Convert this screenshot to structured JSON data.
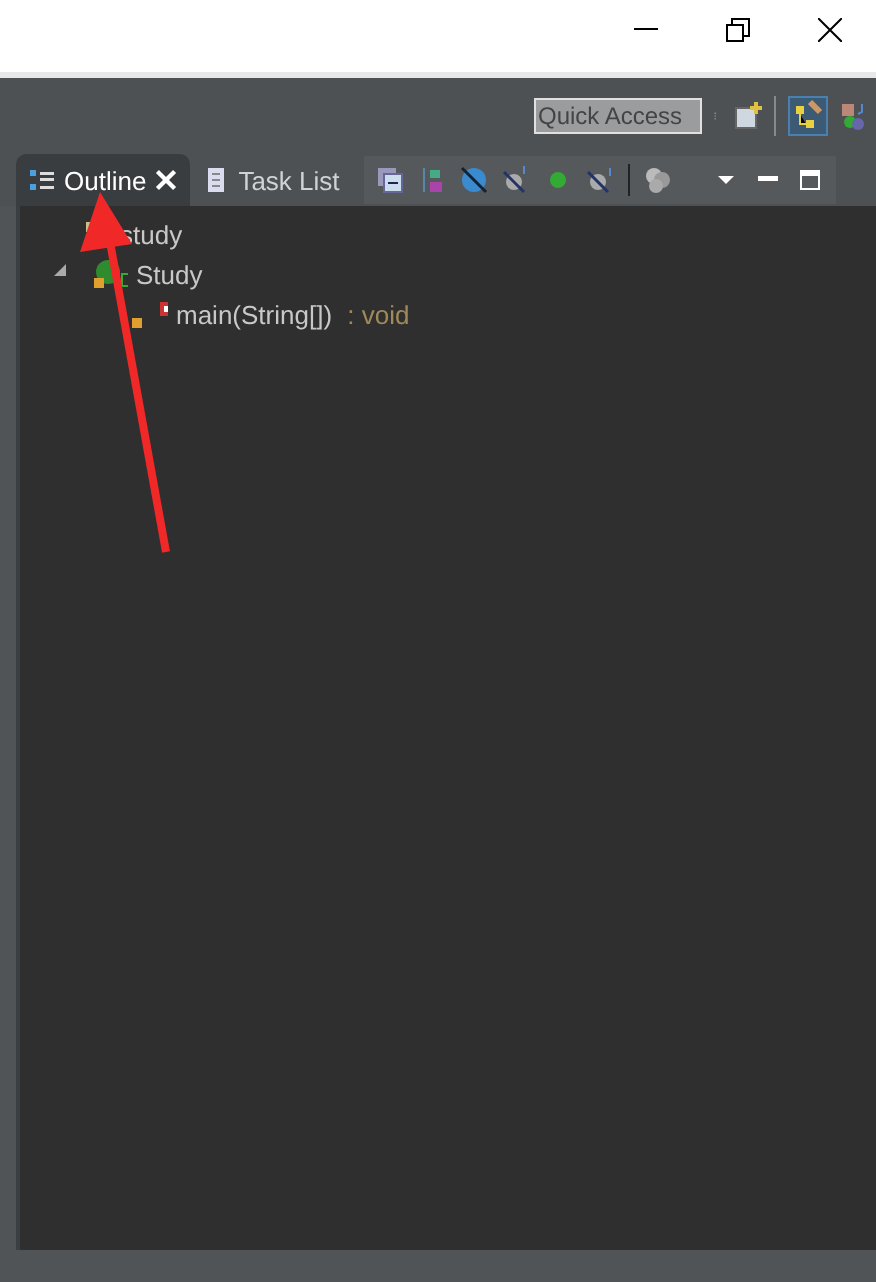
{
  "quick_access": {
    "placeholder": "Quick Access"
  },
  "tabs": [
    {
      "label": "Outline",
      "selected": true,
      "closable": true
    },
    {
      "label": "Task List",
      "selected": false,
      "closable": false
    }
  ],
  "tree": [
    {
      "kind": "package",
      "label": "study"
    },
    {
      "kind": "class",
      "label": "Study",
      "expanded": true,
      "children": [
        {
          "kind": "method",
          "label": "main(String[])",
          "type": " : void"
        }
      ]
    }
  ]
}
